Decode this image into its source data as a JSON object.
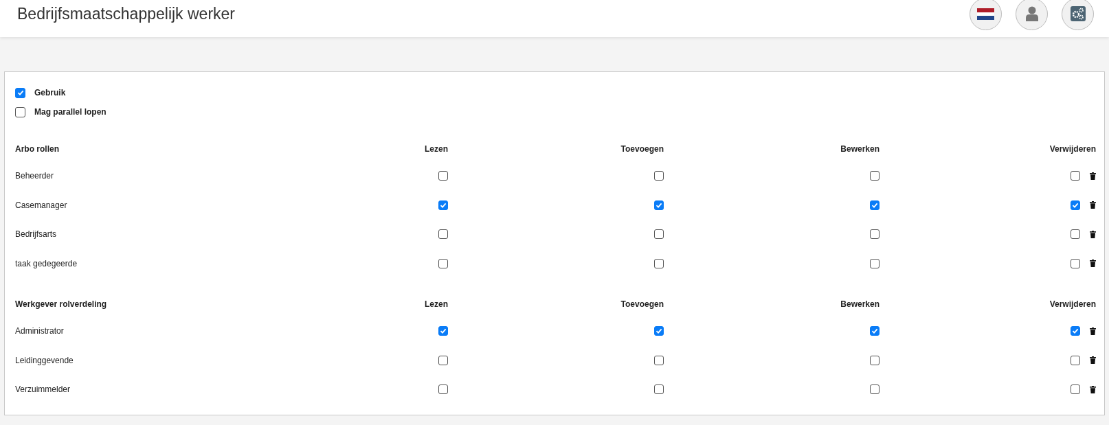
{
  "header": {
    "title": "Bedrijfsmaatschappelijk werker"
  },
  "options": [
    {
      "label": "Gebruik",
      "checked": true
    },
    {
      "label": "Mag parallel lopen",
      "checked": false
    }
  ],
  "sections": [
    {
      "title": "Arbo rollen",
      "columns": [
        "Lezen",
        "Toevoegen",
        "Bewerken",
        "Verwijderen"
      ],
      "rows": [
        {
          "name": "Beheerder",
          "permissions": [
            false,
            false,
            false,
            false
          ]
        },
        {
          "name": "Casemanager",
          "permissions": [
            true,
            true,
            true,
            true
          ]
        },
        {
          "name": "Bedrijfsarts",
          "permissions": [
            false,
            false,
            false,
            false
          ]
        },
        {
          "name": "taak gedegeerde",
          "permissions": [
            false,
            false,
            false,
            false
          ]
        }
      ]
    },
    {
      "title": "Werkgever rolverdeling",
      "columns": [
        "Lezen",
        "Toevoegen",
        "Bewerken",
        "Verwijderen"
      ],
      "rows": [
        {
          "name": "Administrator",
          "permissions": [
            true,
            true,
            true,
            true
          ]
        },
        {
          "name": "Leidinggevende",
          "permissions": [
            false,
            false,
            false,
            false
          ]
        },
        {
          "name": "Verzuimmelder",
          "permissions": [
            false,
            false,
            false,
            false
          ]
        }
      ]
    }
  ]
}
